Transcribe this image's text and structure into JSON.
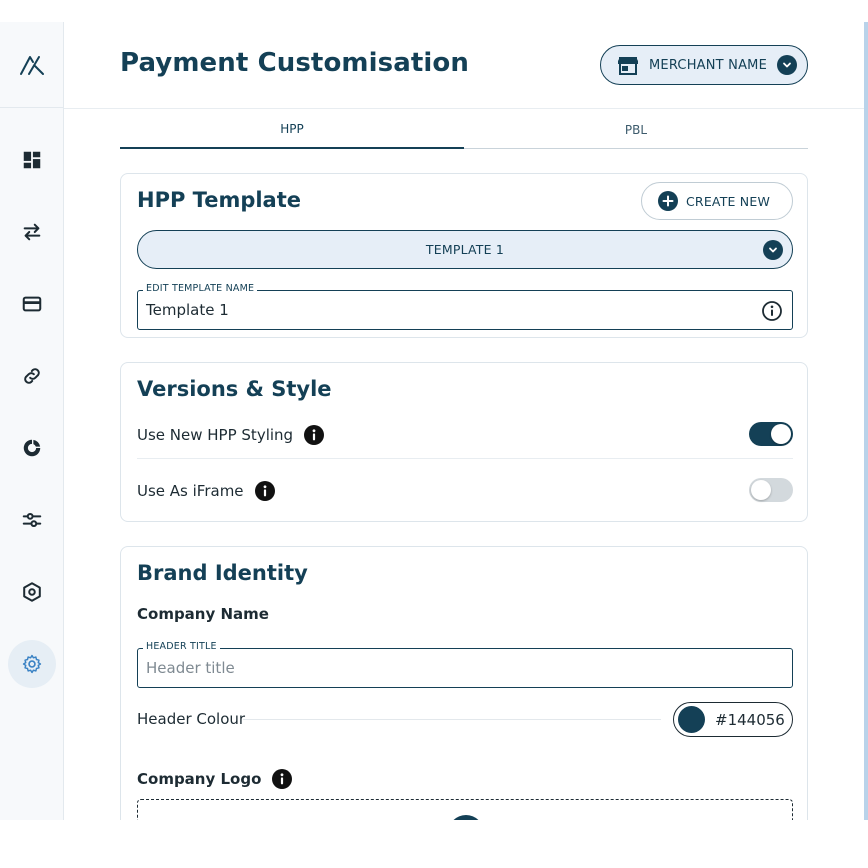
{
  "header": {
    "title": "Payment Customisation",
    "merchant_label": "MERCHANT NAME"
  },
  "sidebar": {
    "items": [
      {
        "icon": "dashboard-icon"
      },
      {
        "icon": "transfer-arrows-icon"
      },
      {
        "icon": "credit-card-icon"
      },
      {
        "icon": "link-icon"
      },
      {
        "icon": "donut-chart-icon"
      },
      {
        "icon": "sliders-icon"
      },
      {
        "icon": "hexagon-settings-icon"
      },
      {
        "icon": "gear-icon",
        "active": true
      }
    ]
  },
  "tabs": [
    {
      "label": "HPP",
      "active": true
    },
    {
      "label": "PBL",
      "active": false
    }
  ],
  "template_card": {
    "title": "HPP Template",
    "create_new_label": "CREATE NEW",
    "selected_template": "TEMPLATE 1",
    "edit_name_label": "EDIT TEMPLATE NAME",
    "edit_name_value": "Template 1"
  },
  "versions_card": {
    "title": "Versions & Style",
    "rows": [
      {
        "label": "Use New HPP Styling",
        "enabled": true
      },
      {
        "label": "Use As iFrame",
        "enabled": false
      }
    ]
  },
  "brand_card": {
    "title": "Brand Identity",
    "company_name_heading": "Company Name",
    "header_title_label": "HEADER TITLE",
    "header_title_placeholder": "Header title",
    "header_colour_label": "Header Colour",
    "header_colour_value": "#144056",
    "company_logo_heading": "Company Logo"
  },
  "colors": {
    "primary": "#144056",
    "accent_bg": "#e6eef7",
    "toggle_off": "#d3d9dd"
  }
}
